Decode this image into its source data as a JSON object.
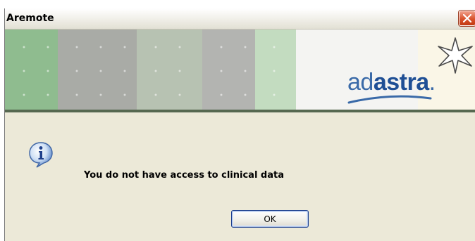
{
  "window": {
    "title": "Aremote",
    "close_icon": "close-icon"
  },
  "banner": {
    "logo_regular": "ad",
    "logo_bold": "astra",
    "logo_suffix": ".",
    "logo_color": "#1f4f95",
    "star_icon": "star-icon",
    "strip_colors": [
      "#8fbc8f",
      "#a9aba6",
      "#b7c2b2",
      "#b3b4b1",
      "#c3dcc0",
      "#f4f4f2",
      "#faf6e7"
    ]
  },
  "dialog": {
    "icon": "info-icon",
    "message": "You do not have access to clinical data",
    "ok_label": "OK"
  }
}
